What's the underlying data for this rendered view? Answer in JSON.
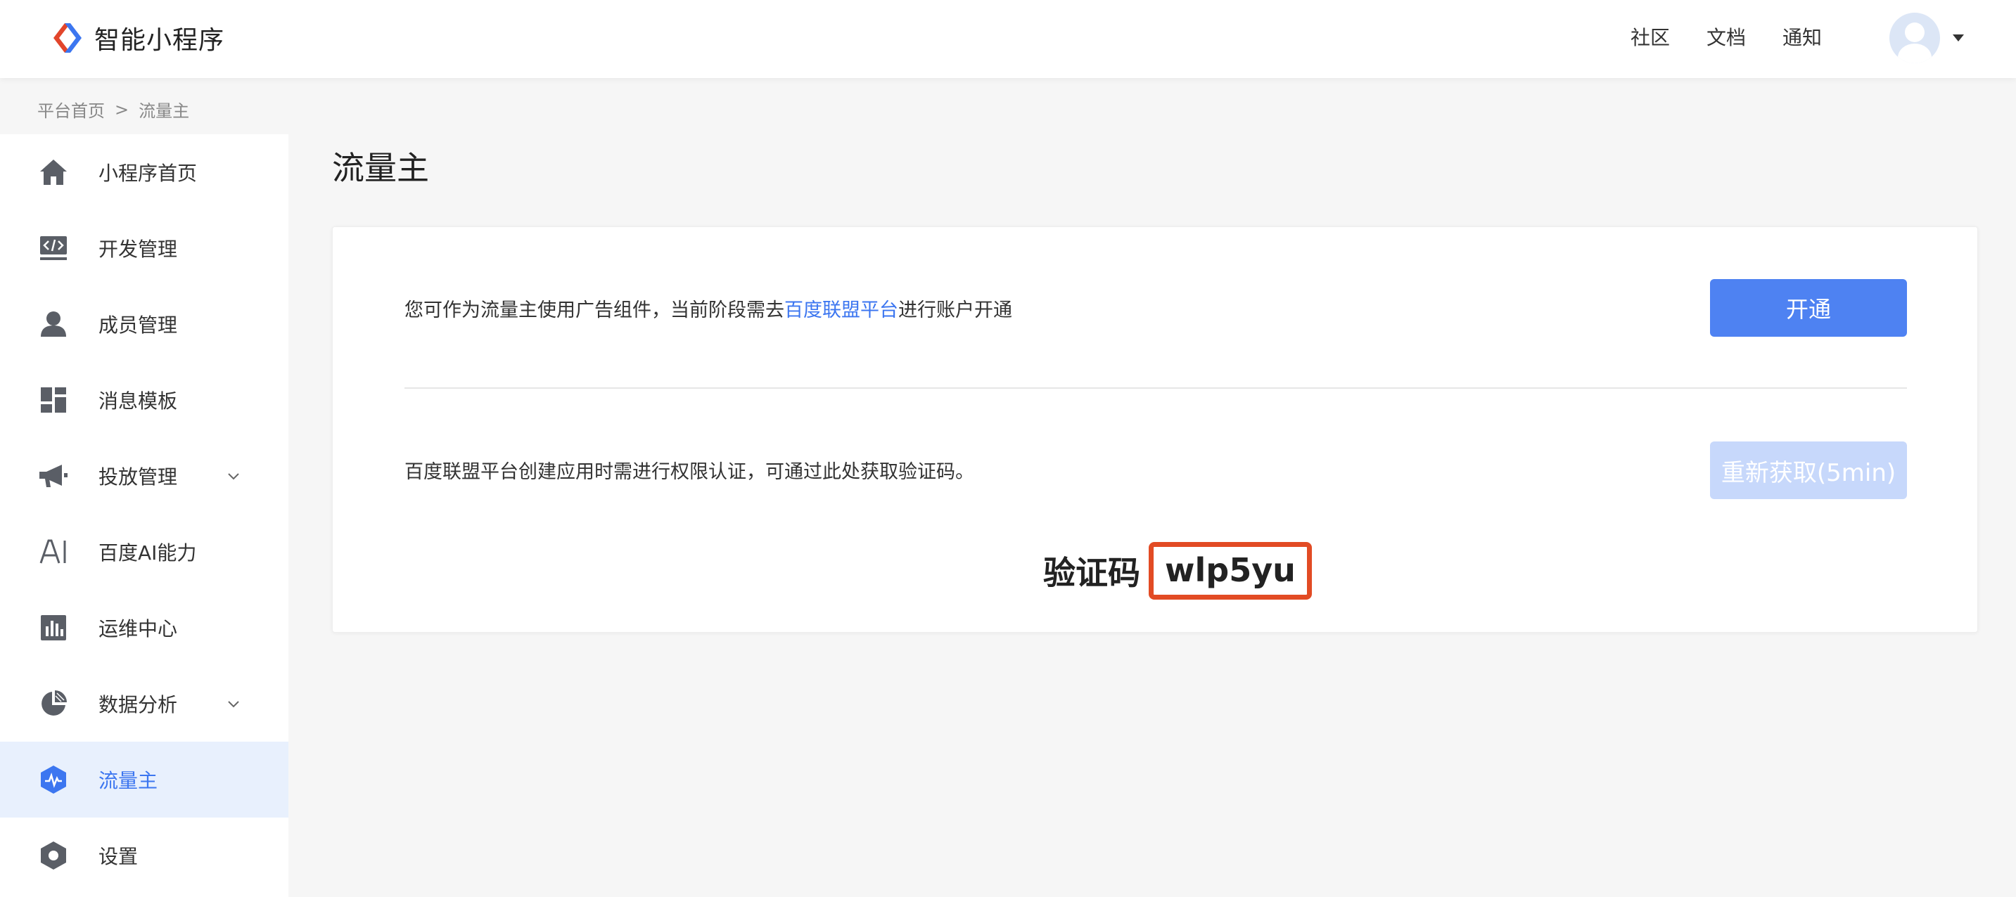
{
  "app": {
    "name": "智能小程序"
  },
  "header": {
    "links": [
      "社区",
      "文档",
      "通知"
    ]
  },
  "breadcrumb": {
    "home": "平台首页",
    "separator": ">",
    "current": "流量主"
  },
  "sidebar": {
    "items": [
      {
        "label": "小程序首页",
        "icon": "home-icon"
      },
      {
        "label": "开发管理",
        "icon": "code-icon"
      },
      {
        "label": "成员管理",
        "icon": "user-icon"
      },
      {
        "label": "消息模板",
        "icon": "template-icon"
      },
      {
        "label": "投放管理",
        "icon": "megaphone-icon",
        "expandable": true
      },
      {
        "label": "百度AI能力",
        "icon": "ai-icon"
      },
      {
        "label": "运维中心",
        "icon": "bar-chart-icon"
      },
      {
        "label": "数据分析",
        "icon": "pie-chart-icon",
        "expandable": true
      },
      {
        "label": "流量主",
        "icon": "traffic-icon",
        "active": true
      },
      {
        "label": "设置",
        "icon": "settings-icon"
      }
    ]
  },
  "main": {
    "title": "流量主",
    "desc1_prefix": "您可作为流量主使用广告组件，当前阶段需去",
    "desc1_link": "百度联盟平台",
    "desc1_suffix": "进行账户开通",
    "open_button": "开通",
    "desc2": "百度联盟平台创建应用时需进行权限认证，可通过此处获取验证码。",
    "refresh_button": "重新获取(5min)",
    "code_label": "验证码",
    "code_value": "wlp5yu"
  },
  "colors": {
    "accent": "#3c76f0",
    "primary_button": "#4e82f2",
    "disabled_button": "#c7d8fb",
    "highlight_box": "#e24b24",
    "active_bg": "#e8f0fd",
    "icon_gray": "#5a5e66"
  }
}
